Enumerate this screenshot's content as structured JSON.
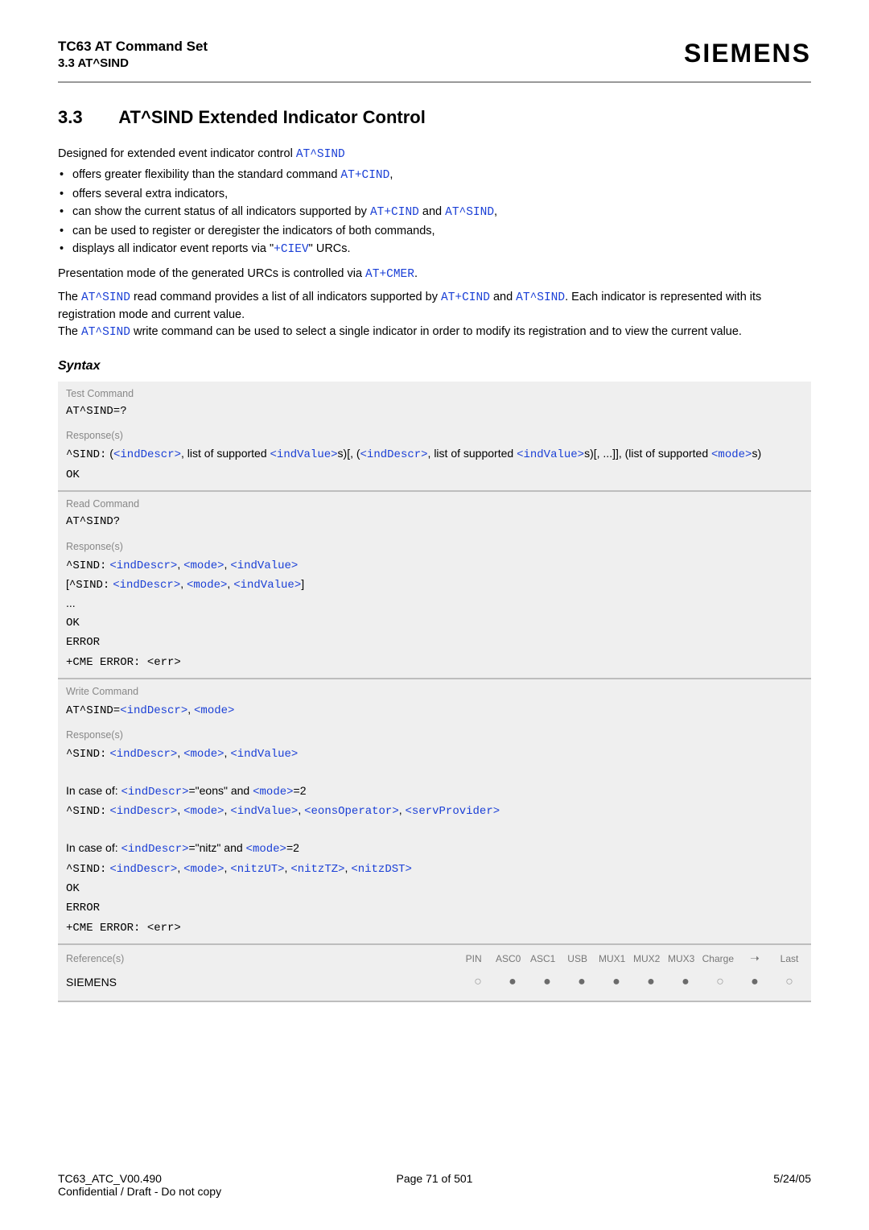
{
  "header": {
    "title": "TC63 AT Command Set",
    "subtitle": "3.3 AT^SIND",
    "logo": "SIEMENS"
  },
  "section": {
    "number": "3.3",
    "name": "AT^SIND   Extended Indicator Control"
  },
  "intro": {
    "lead_a": "Designed for extended event indicator control ",
    "lead_b": "AT^SIND",
    "bullets": {
      "b1a": "offers greater flexibility than the standard command ",
      "b1b": "AT+CIND",
      "b1c": ",",
      "b2": "offers several extra indicators,",
      "b3a": "can show the current status of all indicators supported by ",
      "b3b": "AT+CIND",
      "b3c": " and ",
      "b3d": "AT^SIND",
      "b3e": ",",
      "b4": "can be used to register or deregister the indicators of both commands,",
      "b5a": "displays all indicator event reports via \"",
      "b5b": "+CIEV",
      "b5c": "\" URCs."
    },
    "post_a": "Presentation mode of the generated URCs is controlled via ",
    "post_b": "AT+CMER",
    "post_c": ".",
    "para2": {
      "p1a": "The ",
      "p1b": "AT^SIND",
      "p1c": " read command provides a list of all indicators supported by ",
      "p1d": "AT+CIND",
      "p1e": " and ",
      "p1f": "AT^SIND",
      "p1g": ". Each indicator is represented with its registration mode and current value.",
      "p2a": "The ",
      "p2b": "AT^SIND",
      "p2c": " write command can be used to select a single indicator in order to modify its registration and to view the current value."
    }
  },
  "syntax_label": "Syntax",
  "labels": {
    "test_cmd": "Test Command",
    "response": "Response(s)",
    "read_cmd": "Read Command",
    "write_cmd": "Write Command",
    "reference": "Reference(s)"
  },
  "tokens": {
    "at_sind_q": "AT^SIND=?",
    "caret_sind": "^SIND:",
    "lparen": " (",
    "indDescr": "<indDescr>",
    "comma_list_sup": ", list of supported ",
    "indValue": "<indValue>",
    "s_rparen_lbrack_comma_lparen": "s)[, (",
    "s_rparen_lbrack": "s)[, ...]], (list of supported ",
    "mode": "<mode>",
    "s_rparen": "s)",
    "ok": "OK",
    "at_sind_read": "AT^SIND?",
    "space": " ",
    "comma_sp": ", ",
    "lbrack": "[",
    "rbrack": "]",
    "dots": "...",
    "error": "ERROR",
    "cme": "+CME ERROR: <err>",
    "at_sind_eq": "AT^SIND=",
    "incase_a": "In case of: ",
    "eq_eons_and": "=\"eons\" and ",
    "eq2": "=2",
    "eonsOperator": "<eonsOperator>",
    "servProvider": "<servProvider>",
    "eq_nitz_and": "=\"nitz\" and ",
    "nitzUT": "<nitzUT>",
    "nitzTZ": "<nitzTZ>",
    "nitzDST": "<nitzDST>",
    "siemens": "SIEMENS"
  },
  "ref_cols": [
    "PIN",
    "ASC0",
    "ASC1",
    "USB",
    "MUX1",
    "MUX2",
    "MUX3",
    "Charge",
    "➝",
    "Last"
  ],
  "dots": [
    "○",
    "●",
    "●",
    "●",
    "●",
    "●",
    "●",
    "○",
    "●",
    "○"
  ],
  "footer": {
    "left1": "TC63_ATC_V00.490",
    "left2": "Confidential / Draft - Do not copy",
    "center": "Page 71 of 501",
    "right": "5/24/05"
  }
}
